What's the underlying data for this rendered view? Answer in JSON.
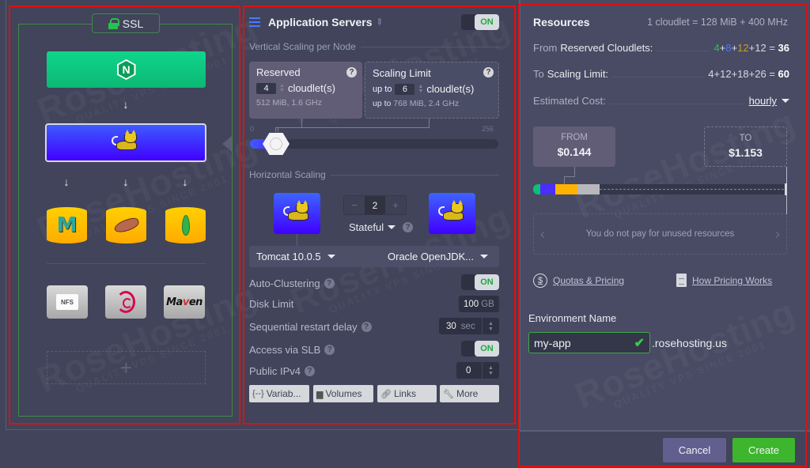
{
  "topology": {
    "ssl_label": "SSL",
    "balancer": {
      "name": "nginx",
      "icon": "nginx-hex-icon"
    },
    "app_server": {
      "name": "tomcat",
      "icon": "tomcat-cat-icon"
    },
    "databases": [
      {
        "name": "mariadb-maxscale",
        "glyph": "M"
      },
      {
        "name": "mariadb",
        "icon": "seal-icon"
      },
      {
        "name": "mongodb",
        "icon": "leaf-icon"
      }
    ],
    "storage": [
      {
        "name": "nfs",
        "label": "NFS"
      },
      {
        "name": "debian",
        "icon": "debian-swirl-icon"
      },
      {
        "name": "maven",
        "label_pre": "Ma",
        "label_v": "v",
        "label_post": "en"
      }
    ],
    "add_symbol": "+"
  },
  "app_servers": {
    "title": "Application Servers",
    "enabled_label": "ON",
    "vertical_scaling_label": "Vertical Scaling per Node",
    "reserved": {
      "title": "Reserved",
      "cloudlets": "4",
      "unit": "cloudlet(s)",
      "spec": "512 MiB, 1.6 GHz"
    },
    "scaling_limit": {
      "title": "Scaling Limit",
      "prefix": "up to",
      "cloudlets": "6",
      "unit": "cloudlet(s)",
      "spec_prefix": "up to",
      "spec": "768 MiB, 2.4 GHz"
    },
    "slider": {
      "min_label": "0",
      "max_label": "256",
      "min": 0,
      "max": 256,
      "reserved": 4,
      "limit": 6
    },
    "horizontal_scaling_label": "Horizontal Scaling",
    "nodes": {
      "minus": "−",
      "count": "2",
      "plus": "+",
      "mode": "Stateful"
    },
    "stack_version": "Tomcat 10.0.5",
    "engine_version": "Oracle OpenJDK...",
    "options": {
      "auto_clustering": {
        "label": "Auto-Clustering",
        "value": "ON"
      },
      "disk_limit": {
        "label": "Disk Limit",
        "value": "100",
        "unit": "GB"
      },
      "restart_delay": {
        "label": "Sequential restart delay",
        "value": "30",
        "unit": "sec"
      },
      "slb_access": {
        "label": "Access via SLB",
        "value": "ON"
      },
      "public_ipv4": {
        "label": "Public IPv4",
        "value": "0"
      }
    },
    "tools": [
      "Variab...",
      "Volumes",
      "Links",
      "More"
    ],
    "help_glyph": "?"
  },
  "resources": {
    "title": "Resources",
    "cloudlet_note": "1 cloudlet = 128 MiB + 400 MHz",
    "reserved_row": {
      "prefix": "From",
      "label": "Reserved Cloudlets:",
      "terms": [
        "4",
        "8",
        "12",
        "12"
      ],
      "total": "36"
    },
    "limit_row": {
      "prefix": "To",
      "label": "Scaling Limit:",
      "terms": [
        "4",
        "12",
        "18",
        "26"
      ],
      "total": "60"
    },
    "estimated_cost_label": "Estimated Cost:",
    "period": "hourly",
    "from": {
      "label": "FROM",
      "value": "$0.144"
    },
    "to": {
      "label": "TO",
      "value": "$1.153"
    },
    "cost_colors": [
      "#0cc078",
      "#4a2dff",
      "#ffb300",
      "#b8b8bc"
    ],
    "info_message": "You do not pay for unused resources",
    "links": {
      "quotas": "Quotas & Pricing",
      "how_pricing": "How Pricing Works"
    },
    "env_name_label": "Environment Name",
    "env_name_value": "my-app",
    "env_domain_suffix": ".rosehosting.us"
  },
  "footer": {
    "cancel_label": "Cancel",
    "create_label": "Create"
  },
  "watermark": {
    "brand": "RoseHosting",
    "tagline": "QUALITY VPS SINCE 2001"
  }
}
